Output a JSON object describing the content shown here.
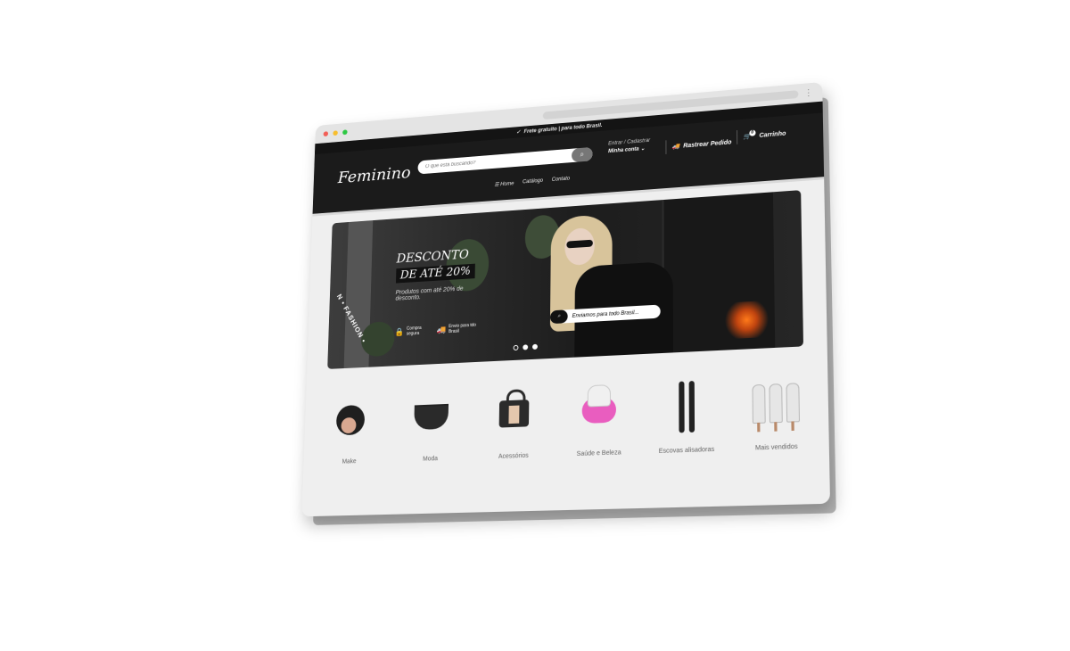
{
  "browser": {
    "colors": {
      "close": "#f25f57",
      "min": "#f7be2f",
      "max": "#2dc843"
    }
  },
  "topbar": {
    "text": "Frete gratuito | para todo Brasil."
  },
  "header": {
    "logo": "Feminino",
    "search_placeholder": "O que está buscando?",
    "account_sub": "Entrar / Cadastrar",
    "account_main": "Minha conta",
    "track": "Rastrear Pedido",
    "cart": "Carrinho",
    "cart_count": "0"
  },
  "menu": {
    "home": "Home",
    "catalog": "Catálogo",
    "contact": "Contato"
  },
  "banner": {
    "title1": "DESCONTO",
    "title2": "DE ATÉ 20%",
    "desc": "Produtos com até 20% de desconto.",
    "feature1": "Compra segura",
    "feature2": "Envio para tdo Brasil",
    "badge": "N • FASHION •",
    "ship_text": "Enviamos para todo Brasil..."
  },
  "categories": [
    {
      "label": "Make",
      "icon": "compact-icon"
    },
    {
      "label": "Moda",
      "icon": "bra-icon"
    },
    {
      "label": "Acessórios",
      "icon": "bag-icon"
    },
    {
      "label": "Saúde e Beleza",
      "icon": "epilator-icon"
    },
    {
      "label": "Escovas alisadoras",
      "icon": "brush-icon"
    },
    {
      "label": "Mais vendidos",
      "icon": "ipl-icon"
    }
  ]
}
